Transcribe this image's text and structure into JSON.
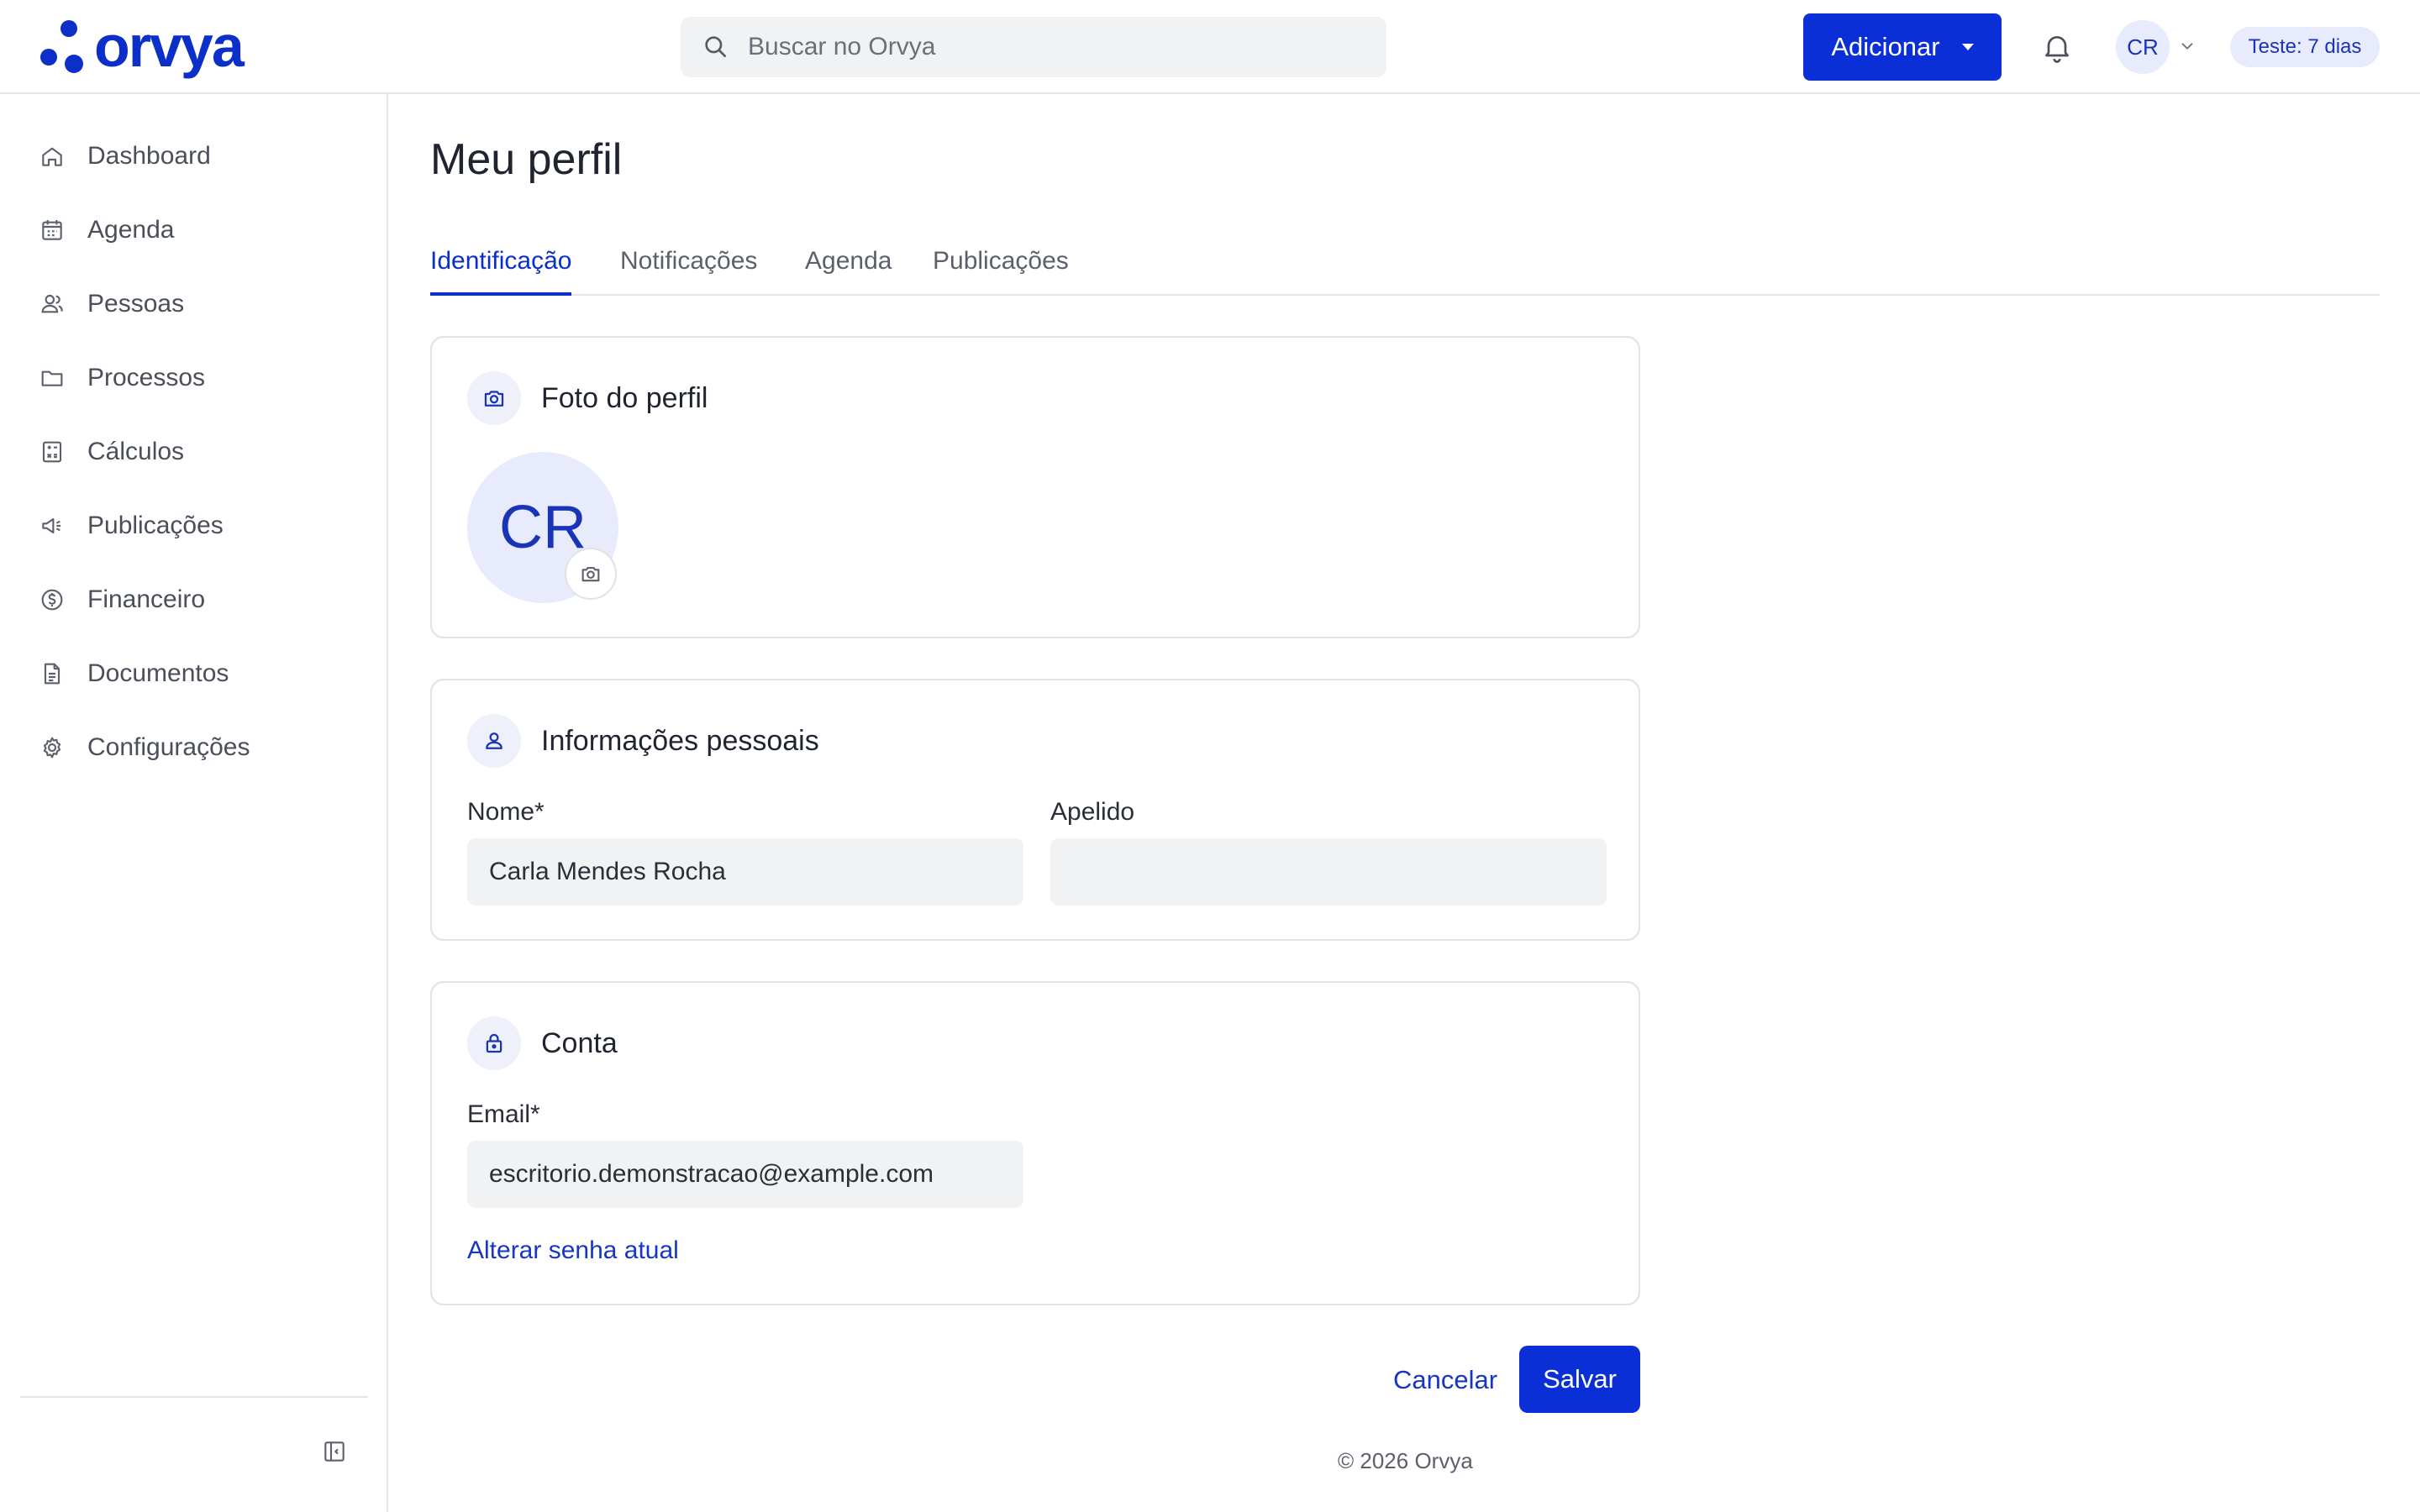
{
  "brand": {
    "name": "orvya",
    "color": "#0d2fc9"
  },
  "search": {
    "placeholder": "Buscar no Orvya"
  },
  "header": {
    "add_label": "Adicionar",
    "user_initials": "CR",
    "trial_label": "Teste: 7 dias"
  },
  "sidebar": {
    "items": [
      {
        "label": "Dashboard",
        "icon": "home-icon"
      },
      {
        "label": "Agenda",
        "icon": "calendar-icon"
      },
      {
        "label": "Pessoas",
        "icon": "people-icon"
      },
      {
        "label": "Processos",
        "icon": "folder-icon"
      },
      {
        "label": "Cálculos",
        "icon": "calculator-icon"
      },
      {
        "label": "Publicações",
        "icon": "megaphone-icon"
      },
      {
        "label": "Financeiro",
        "icon": "dollar-icon"
      },
      {
        "label": "Documentos",
        "icon": "document-icon"
      },
      {
        "label": "Configurações",
        "icon": "gear-icon"
      }
    ]
  },
  "page": {
    "title": "Meu perfil"
  },
  "tabs": [
    {
      "label": "Identificação",
      "active": true
    },
    {
      "label": "Notificações",
      "active": false
    },
    {
      "label": "Agenda",
      "active": false
    },
    {
      "label": "Publicações",
      "active": false
    }
  ],
  "photo_card": {
    "title": "Foto do perfil",
    "initials": "CR"
  },
  "personal_card": {
    "title": "Informações pessoais",
    "name_label": "Nome*",
    "name_value": "Carla Mendes Rocha",
    "nickname_label": "Apelido",
    "nickname_value": ""
  },
  "account_card": {
    "title": "Conta",
    "email_label": "Email*",
    "email_value": "escritorio.demonstracao@example.com",
    "change_password_label": "Alterar senha atual"
  },
  "actions": {
    "cancel_label": "Cancelar",
    "save_label": "Salvar"
  },
  "footer": {
    "text": "© 2026 Orvya"
  },
  "colors": {
    "accent": "#0b2fd6",
    "accent_light": "#e7ebfb",
    "border": "#e3e5ea",
    "field_bg": "#f1f2f4"
  }
}
